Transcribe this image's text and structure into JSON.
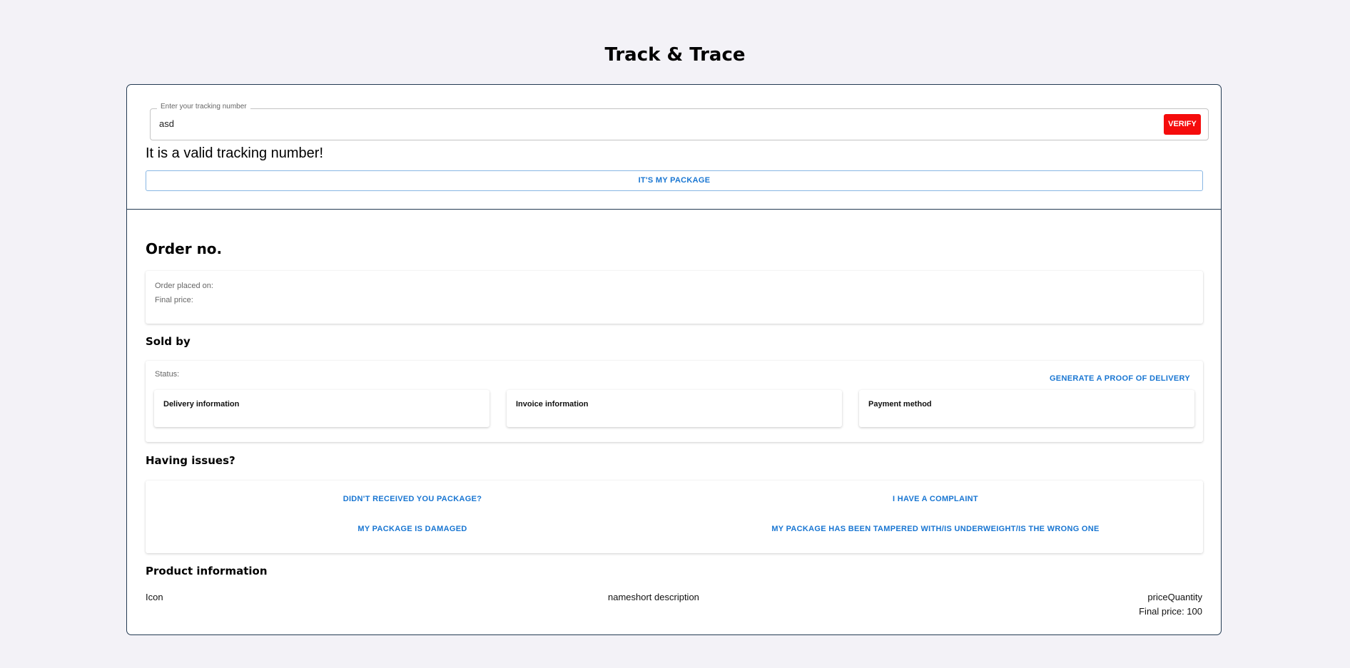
{
  "page": {
    "title": "Track & Trace"
  },
  "tracking": {
    "label": "Enter your tracking number",
    "value": "asd",
    "verify_label": "VERIFY",
    "valid_message": "It is a valid tracking number!",
    "my_package_label": "IT'S MY PACKAGE"
  },
  "order": {
    "title": "Order no.",
    "placed_on_label": "Order placed on:",
    "final_price_label": "Final price:"
  },
  "sold_by": {
    "title": "Sold by",
    "status_label": "Status:",
    "proof_button": "GENERATE A PROOF OF DELIVERY",
    "cards": [
      {
        "label": "Delivery information"
      },
      {
        "label": "Invoice information"
      },
      {
        "label": "Payment method"
      }
    ]
  },
  "issues": {
    "title": "Having issues?",
    "buttons": [
      "DIDN'T RECEIVED YOU PACKAGE?",
      "I HAVE A COMPLAINT",
      "MY PACKAGE IS DAMAGED",
      "MY PACKAGE HAS BEEN TAMPERED WITH/IS UNDERWEIGHT/IS THE WRONG ONE"
    ]
  },
  "product": {
    "title": "Product information",
    "icon_col": "Icon",
    "name_col": "nameshort description",
    "price_col": "priceQuantity",
    "final_price": "Final price: 100"
  },
  "colors": {
    "background": "#f3f2f7",
    "accent": "#1976d2",
    "verify": "#f50c0c",
    "border": "#233a52"
  }
}
